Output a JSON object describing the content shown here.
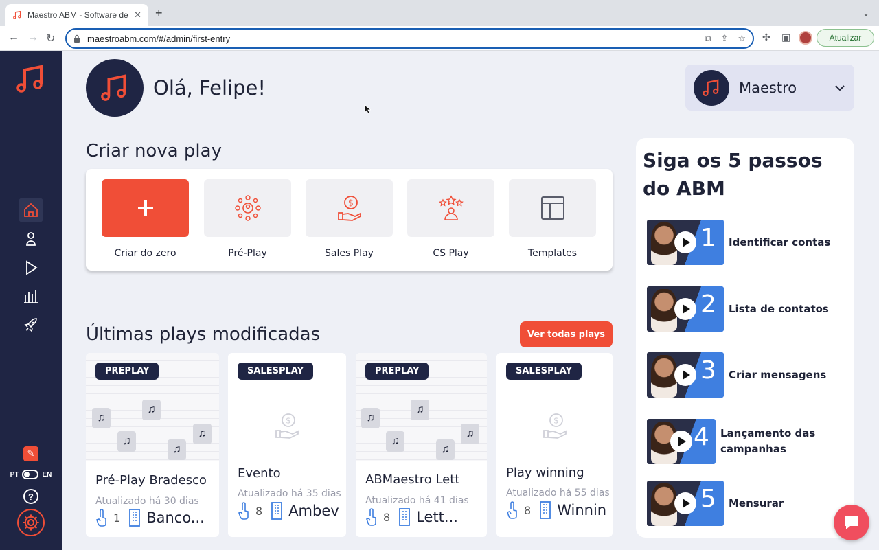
{
  "browser": {
    "tab_title": "Maestro ABM - Software de A",
    "url": "maestroabm.com/#/admin/first-entry",
    "update_label": "Atualizar"
  },
  "colors": {
    "brand": "#f04e37",
    "navy": "#1f2544",
    "step_blue": "#3f7fe0"
  },
  "sidebar": {
    "items": [
      {
        "name": "home-icon",
        "active": true
      },
      {
        "name": "user-icon",
        "active": false
      },
      {
        "name": "play-icon",
        "active": false
      },
      {
        "name": "analytics-icon",
        "active": false
      },
      {
        "name": "rocket-icon",
        "active": false
      }
    ],
    "lang_pt": "PT",
    "lang_en": "EN",
    "help_label": "?"
  },
  "header": {
    "greeting": "Olá, Felipe!",
    "org_name": "Maestro"
  },
  "create": {
    "title": "Criar nova play",
    "items": [
      {
        "label": "Criar do zero",
        "icon": "plus-icon"
      },
      {
        "label": "Pré-Play",
        "icon": "network-icon"
      },
      {
        "label": "Sales Play",
        "icon": "coin-hand-icon"
      },
      {
        "label": "CS Play",
        "icon": "stars-person-icon"
      },
      {
        "label": "Templates",
        "icon": "template-icon"
      }
    ]
  },
  "recent": {
    "title": "Últimas plays modificadas",
    "view_all_label": "Ver todas plays",
    "cards": [
      {
        "badge": "PREPLAY",
        "name": "Pré-Play Bradesco",
        "updated": "Atualizado há 30 dias",
        "count": "1",
        "company": "Banco..."
      },
      {
        "badge": "SALESPLAY",
        "name": "Evento",
        "updated": "Atualizado há 35 dias",
        "count": "8",
        "company": "Ambev"
      },
      {
        "badge": "PREPLAY",
        "name": "ABMaestro Lett",
        "updated": "Atualizado há 41 dias",
        "count": "8",
        "company": "Lett..."
      },
      {
        "badge": "SALESPLAY",
        "name": "Play winning",
        "updated": "Atualizado há 55 dias",
        "count": "8",
        "company": "Winnin"
      }
    ]
  },
  "steps": {
    "title": "Siga os 5 passos do ABM",
    "items": [
      {
        "num": "1",
        "label": "Identificar contas"
      },
      {
        "num": "2",
        "label": "Lista de contatos"
      },
      {
        "num": "3",
        "label": "Criar mensagens"
      },
      {
        "num": "4",
        "label": "Lançamento das campanhas"
      },
      {
        "num": "5",
        "label": "Mensurar"
      }
    ]
  }
}
